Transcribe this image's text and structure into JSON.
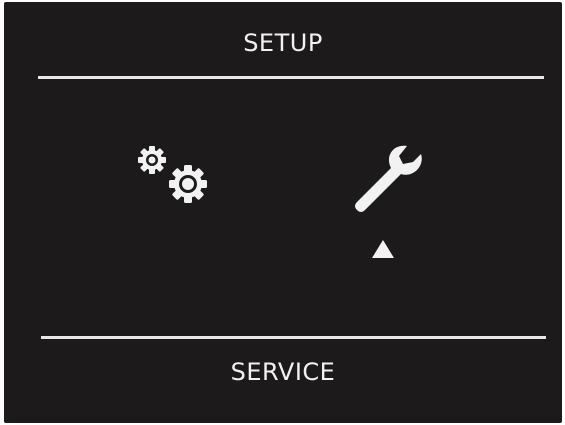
{
  "header": {
    "title": "SETUP"
  },
  "menu": {
    "items": [
      {
        "icon": "gears-icon",
        "selected": false
      },
      {
        "icon": "wrench-icon",
        "selected": true
      }
    ],
    "selection_indicator_icon": "triangle-up-icon"
  },
  "footer": {
    "label": "SERVICE"
  },
  "colors": {
    "background": "#1c1a1a",
    "foreground": "#f2f2f2"
  }
}
